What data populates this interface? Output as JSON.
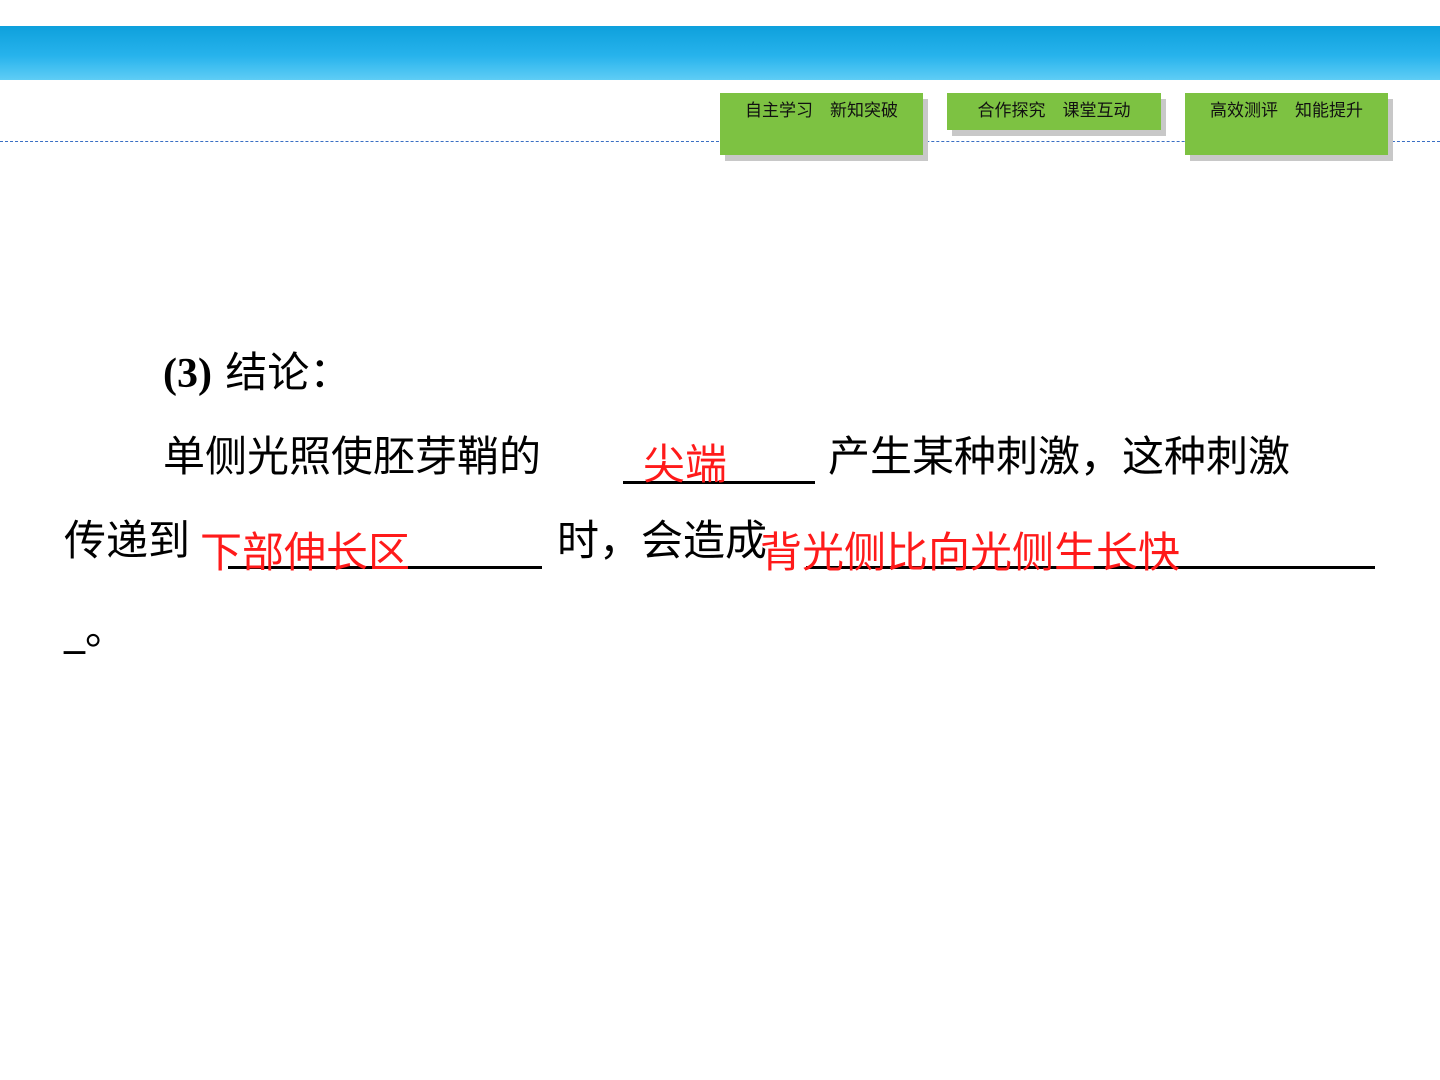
{
  "nav": {
    "btn1": "自主学习　新知突破",
    "btn2": "合作探究　课堂互动",
    "btn3": "高效测评　知能提升"
  },
  "content": {
    "heading_num": "(3)",
    "heading_text": " 结论：",
    "line1_prefix": "单侧光照使胚芽鞘的",
    "line1_mid": "产生某种刺激，这种刺激",
    "line2_prefix": "传递到",
    "line2_mid": "时，会造成",
    "line3_end": "_。",
    "answer1": "尖端",
    "answer2": "下部伸长区",
    "answer3": "背光侧比向光侧生长快"
  },
  "colors": {
    "banner": "#27b3ec",
    "nav_button": "#7dc242",
    "answer": "#ff1a1a",
    "dashed_line": "#3a6fc4"
  }
}
